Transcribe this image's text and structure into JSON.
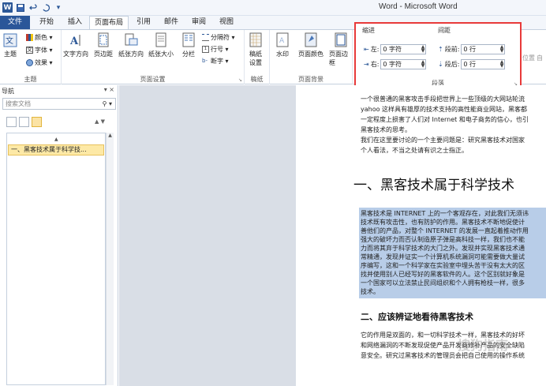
{
  "window": {
    "title": "Word - Microsoft Word",
    "logo": "W"
  },
  "quick_access": {
    "items": [
      "save-icon",
      "undo-icon",
      "redo-icon",
      "customize-icon"
    ]
  },
  "tabs": [
    "文件",
    "开始",
    "插入",
    "页面布局",
    "引用",
    "邮件",
    "审阅",
    "视图"
  ],
  "ribbon": {
    "theme": {
      "main_label": "主题",
      "colors": "颜色 ▾",
      "fonts": "字体 ▾",
      "effects": "效果 ▾",
      "group": "主题"
    },
    "page_setup": {
      "text_direction": "文字方向",
      "margins": "页边距",
      "orientation": "纸张方向",
      "size": "纸张大小",
      "columns": "分栏",
      "breaks": "分隔符 ▾",
      "line_numbers": "行号 ▾",
      "hyphenation": "断字 ▾",
      "group": "页面设置"
    },
    "draft": {
      "label_line1": "稿纸",
      "label_line2": "设置",
      "group": "稿纸"
    },
    "page_background": {
      "watermark": "水印",
      "page_color": "页面颜色",
      "page_borders": "页面边框",
      "group": "页面背景"
    },
    "paragraph": {
      "indent_header": "缩进",
      "spacing_header": "间距",
      "left_label": "左:",
      "left_value": "0 字符",
      "right_label": "右:",
      "right_value": "0 字符",
      "before_label": "段前:",
      "before_value": "0 行",
      "after_label": "段后:",
      "after_value": "0 行",
      "group": "段落"
    },
    "arrange": {
      "position": "位置",
      "wrap": "自"
    }
  },
  "nav_pane": {
    "title": "导航",
    "search_placeholder": "搜索文档",
    "heading_item": "一、黑客技术属于科学技..."
  },
  "document": {
    "top_lines": [
      "一个很普通的黑客攻击手段把世界上一些顶级的大网站轮流",
      "yahoo 这样具有雄厚的技术支持的高性能商业网站，黑客都",
      "一定程度上损害了人们对 Internet 和电子商务的信心，也引",
      "黑客技术的思考。",
      "我们在这里要讨论的一个主要问题是：研究黑客技术对国家",
      "个人看法，不当之处请有识之士指正。"
    ],
    "heading1": "一、黑客技术属于科学技术",
    "selected_lines": [
      "黑客技术是 INTERNET 上的一个客观存在，对此我们无须讳",
      "技术既有攻击性，也有防护的作用。黑客技术不断地促使计",
      "善他们的产品，对整个 INTERNET 的发展一直起着推动作用",
      "强大的破坏力而否认制造原子弹是高科技一样，我们也不能",
      "力而将其弃于科学技术的大门之外。发现并实现黑客技术通",
      "常精通，发现并证实一个计算机系统漏洞可能需要做大量试",
      "序编写，这和一个科学家在实验室中埋头苦干没有太大的区",
      "找并使用别人已经写好的黑客软件的人。这个区别就好象是",
      "一个国家可以立法禁止民间组织和个人拥有枪枝一样，很多",
      "技术。"
    ],
    "heading2": "二、应该辨证地看待黑客技术",
    "bottom_lines": [
      "它的作用是双面的，和一切科学技术一样，黑客技术的好坏",
      "和网络漏洞的不断发现促使产品开发商修补产品的安全缺陷",
      "意安全。研究过黑客技术的管理员会把自己使用的操作系统"
    ],
    "watermark": "搜狗指南"
  }
}
